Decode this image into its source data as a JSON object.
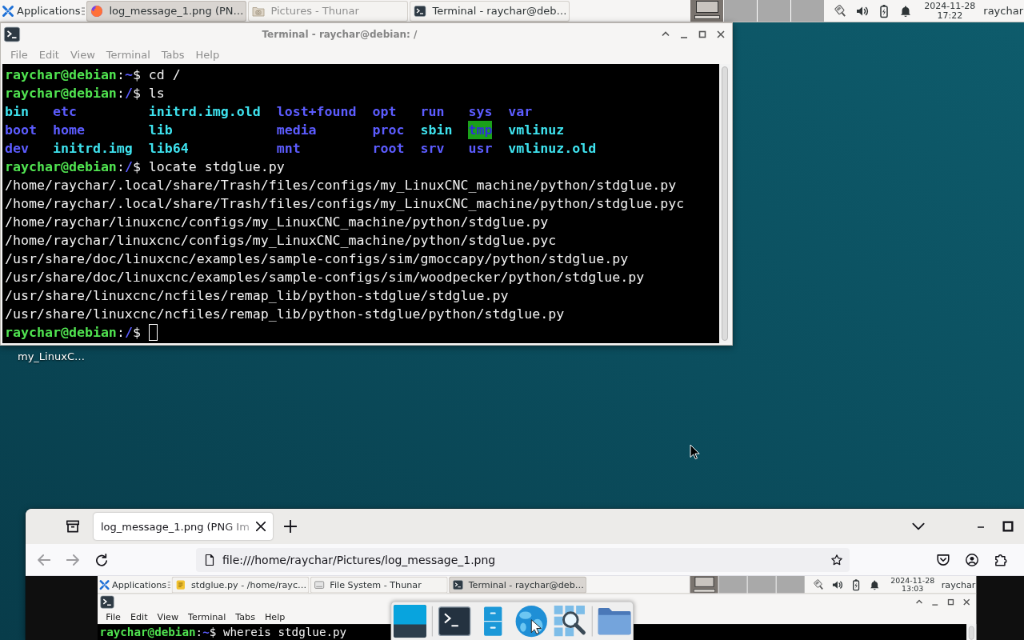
{
  "top_panel": {
    "applications_label": "Applications",
    "tasks": [
      {
        "title": "log_message_1.png (PN…",
        "kind": "browser",
        "selected": true,
        "minimized": false
      },
      {
        "title": "Pictures - Thunar",
        "kind": "folder",
        "selected": false,
        "minimized": true
      },
      {
        "title": "Terminal - raychar@deb…",
        "kind": "terminal",
        "selected": false,
        "minimized": false
      }
    ],
    "workspaces": [
      {
        "selected": true
      },
      {
        "selected": false
      },
      {
        "selected": false
      },
      {
        "selected": false
      }
    ],
    "clock": {
      "date": "2024-11-28",
      "time": "17:22"
    },
    "user": "raychar"
  },
  "terminal_window": {
    "active": false,
    "title": "Terminal - raychar@debian: /",
    "menu": [
      "File",
      "Edit",
      "View",
      "Terminal",
      "Tabs",
      "Help"
    ],
    "lines": [
      {
        "kind": "prompt",
        "user": "raychar@debian",
        "separator": ":",
        "path": "~",
        "symbol": "$",
        "command": "cd /",
        "cursor": false
      },
      {
        "kind": "prompt",
        "user": "raychar@debian",
        "separator": ":",
        "path": "/",
        "symbol": "$",
        "command": "ls",
        "cursor": false
      },
      {
        "kind": "listing",
        "rows": [
          [
            {
              "name": "bin",
              "kind": "link"
            },
            {
              "name": "etc",
              "kind": "directory"
            },
            {
              "name": "initrd.img.old",
              "kind": "link"
            },
            {
              "name": "lost+found",
              "kind": "directory"
            },
            {
              "name": "opt",
              "kind": "directory"
            },
            {
              "name": "run",
              "kind": "directory"
            },
            {
              "name": "sys",
              "kind": "directory"
            },
            {
              "name": "var",
              "kind": "directory"
            }
          ],
          [
            {
              "name": "boot",
              "kind": "directory"
            },
            {
              "name": "home",
              "kind": "directory"
            },
            {
              "name": "lib",
              "kind": "link"
            },
            {
              "name": "media",
              "kind": "directory"
            },
            {
              "name": "proc",
              "kind": "directory"
            },
            {
              "name": "sbin",
              "kind": "link"
            },
            {
              "name": "tmp",
              "kind": "sticky-directory"
            },
            {
              "name": "vmlinuz",
              "kind": "link"
            }
          ],
          [
            {
              "name": "dev",
              "kind": "directory"
            },
            {
              "name": "initrd.img",
              "kind": "link"
            },
            {
              "name": "lib64",
              "kind": "link"
            },
            {
              "name": "mnt",
              "kind": "directory"
            },
            {
              "name": "root",
              "kind": "directory"
            },
            {
              "name": "srv",
              "kind": "directory"
            },
            {
              "name": "usr",
              "kind": "directory"
            },
            {
              "name": "vmlinuz.old",
              "kind": "link"
            }
          ]
        ]
      },
      {
        "kind": "prompt",
        "user": "raychar@debian",
        "separator": ":",
        "path": "/",
        "symbol": "$",
        "command": "locate stdglue.py",
        "cursor": false
      },
      {
        "kind": "output",
        "text": "/home/raychar/.local/share/Trash/files/configs/my_LinuxCNC_machine/python/stdglue.py"
      },
      {
        "kind": "output",
        "text": "/home/raychar/.local/share/Trash/files/configs/my_LinuxCNC_machine/python/stdglue.pyc"
      },
      {
        "kind": "output",
        "text": "/home/raychar/linuxcnc/configs/my_LinuxCNC_machine/python/stdglue.py"
      },
      {
        "kind": "output",
        "text": "/home/raychar/linuxcnc/configs/my_LinuxCNC_machine/python/stdglue.pyc"
      },
      {
        "kind": "output",
        "text": "/usr/share/doc/linuxcnc/examples/sample-configs/sim/gmoccapy/python/stdglue.py"
      },
      {
        "kind": "output",
        "text": "/usr/share/doc/linuxcnc/examples/sample-configs/sim/woodpecker/python/stdglue.py"
      },
      {
        "kind": "output",
        "text": "/usr/share/linuxcnc/ncfiles/remap_lib/python-stdglue/stdglue.py"
      },
      {
        "kind": "output",
        "text": "/usr/share/linuxcnc/ncfiles/remap_lib/python-stdglue/python/stdglue.py"
      },
      {
        "kind": "prompt",
        "user": "raychar@debian",
        "separator": ":",
        "path": "/",
        "symbol": "$",
        "cursor": true
      }
    ]
  },
  "desktop_icons": [
    {
      "label": "my_LinuxC…"
    }
  ],
  "browser": {
    "tabs": [
      {
        "title": "log_message_1.png (PNG Im",
        "selected": true
      }
    ],
    "back_disabled": true,
    "forward_disabled": true,
    "url": "file:///home/raychar/Pictures/log_message_1.png",
    "page": {
      "panel": {
        "applications_label": "Applications",
        "tasks": [
          {
            "title": "stdglue.py - /home/rayc…",
            "kind": "editor",
            "selected": false,
            "minimized": false
          },
          {
            "title": "File System - Thunar",
            "kind": "drive",
            "selected": false,
            "minimized": false
          },
          {
            "title": "Terminal - raychar@deb…",
            "kind": "terminal",
            "selected": true,
            "minimized": false
          }
        ],
        "workspaces": [
          {
            "selected": true
          },
          {
            "selected": false
          },
          {
            "selected": false
          },
          {
            "selected": false
          }
        ],
        "clock": {
          "date": "2024-11-28",
          "time": "13:03"
        },
        "user": "raychar"
      },
      "terminal_window": {
        "active": true,
        "menu": [
          "File",
          "Edit",
          "View",
          "Terminal",
          "Tabs",
          "Help"
        ],
        "lines": [
          {
            "kind": "prompt",
            "user": "raychar@debian",
            "separator": ":",
            "path": "~",
            "symbol": "$",
            "command": "whereis stdglue.py",
            "cursor": false
          }
        ]
      }
    }
  }
}
